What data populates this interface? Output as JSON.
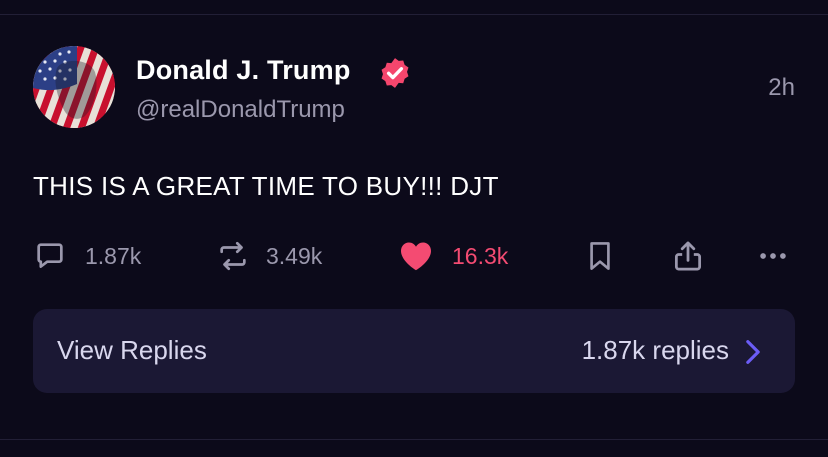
{
  "post": {
    "author_name": "Donald J. Trump",
    "author_handle": "@realDonaldTrump",
    "time_ago": "2h",
    "text": "THIS IS A GREAT TIME TO BUY!!! DJT",
    "verified_icon": "verified-badge-icon",
    "avatar_icon": "avatar-image"
  },
  "actions": {
    "replies_count": "1.87k",
    "reposts_count": "3.49k",
    "likes_count": "16.3k",
    "reply_icon": "comment-icon",
    "repost_icon": "repost-icon",
    "like_icon": "heart-icon",
    "bookmark_icon": "bookmark-icon",
    "share_icon": "share-icon",
    "more_icon": "more-icon"
  },
  "replies_bar": {
    "label": "View Replies",
    "count": "1.87k replies",
    "chevron_icon": "chevron-right-icon"
  },
  "colors": {
    "background": "#0c0a1a",
    "accent_like": "#f44b72",
    "verified": "#f5466d",
    "muted_text": "#9b98ad",
    "replies_bar": "#1b1834",
    "chevron": "#6b5cf5"
  }
}
